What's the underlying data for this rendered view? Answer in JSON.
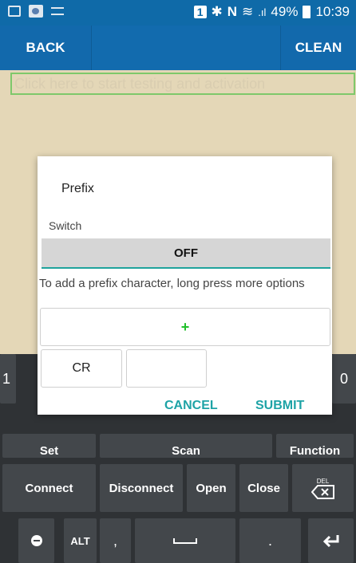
{
  "status_bar": {
    "badge": "1",
    "bt_symbol": "✱",
    "nfc_symbol": "N",
    "wifi_symbol": "≋",
    "signal_symbol": ".ıl",
    "battery": "49%",
    "time": "10:39"
  },
  "app_bar": {
    "back_label": "BACK",
    "clean_label": "CLEAN"
  },
  "test_field": {
    "placeholder": "Click here to start testing and activation"
  },
  "dialog": {
    "title": "Prefix",
    "switch_label": "Switch",
    "switch_value": "OFF",
    "hint": "To add a prefix character, long press more options",
    "add_symbol": "+",
    "chips": [
      "CR",
      ""
    ],
    "cancel_label": "CANCEL",
    "submit_label": "SUBMIT"
  },
  "keyboard": {
    "row1_left": "1",
    "row1_right": "0",
    "row2": [
      "Set",
      "Scan",
      "Function"
    ],
    "row3": [
      "Connect",
      "Disconnect",
      "Open",
      "Close",
      "DEL"
    ],
    "row4": [
      "ALT",
      ",",
      "."
    ]
  },
  "colors": {
    "app_bar": "#126bae",
    "background": "#e4d7b7",
    "accent": "#1ea3a6",
    "add_plus": "#22c02c"
  }
}
